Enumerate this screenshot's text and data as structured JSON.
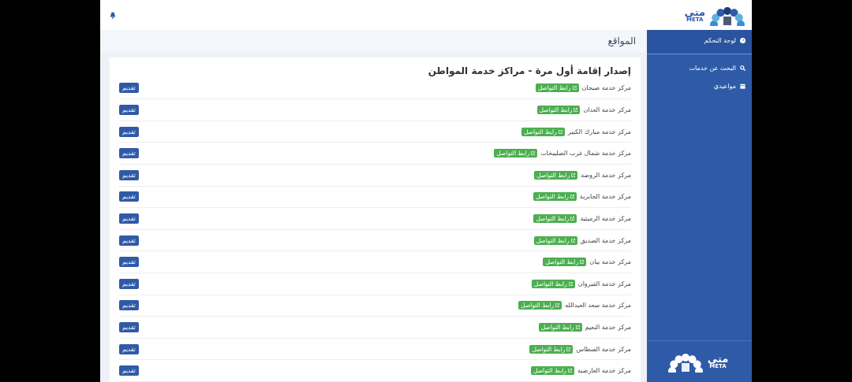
{
  "header": {
    "logo": {
      "arabic": "متى",
      "latin": "META"
    }
  },
  "sidebar": {
    "items": [
      {
        "label": "لوحة التحكم",
        "kind": "dashboard",
        "selected": true
      },
      {
        "label": "البحث عن خدمات",
        "kind": "search",
        "selected": false
      },
      {
        "label": "مواعيدي",
        "kind": "calendar",
        "selected": false
      }
    ],
    "logo": {
      "arabic": "متى",
      "latin": "META"
    }
  },
  "page_title": "المواقع",
  "section_title": "إصدار إقامة أول مرة - مراكز خدمة المواطن",
  "locations": [
    {
      "name": "مركز خدمة صبحان",
      "link": "رابط التواصل",
      "action": "تقديم"
    },
    {
      "name": "مركز خدمة العدان",
      "link": "رابط التواصل",
      "action": "تقديم"
    },
    {
      "name": "مركز خدمة مبارك الكبير",
      "link": "رابط التواصل",
      "action": "تقديم"
    },
    {
      "name": "مركز خدمة شمال غرب الصليبخات",
      "link": "رابط التواصل",
      "action": "تقديم"
    },
    {
      "name": "مركز خدمة الروضة",
      "link": "رابط التواصل",
      "action": "تقديم"
    },
    {
      "name": "مركز خدمة الجابرية",
      "link": "رابط التواصل",
      "action": "تقديم"
    },
    {
      "name": "مركز خدمة الرميثية",
      "link": "رابط التواصل",
      "action": "تقديم"
    },
    {
      "name": "مركز خدمة الصديق",
      "link": "رابط التواصل",
      "action": "تقديم"
    },
    {
      "name": "مركز خدمة بيان",
      "link": "رابط التواصل",
      "action": "تقديم"
    },
    {
      "name": "مركز خدمة القيروان",
      "link": "رابط التواصل",
      "action": "تقديم"
    },
    {
      "name": "مركز خدمة سعد العبدالله",
      "link": "رابط التواصل",
      "action": "تقديم"
    },
    {
      "name": "مركز خدمة النعيم",
      "link": "رابط التواصل",
      "action": "تقديم"
    },
    {
      "name": "مركز خدمة الفنطاس",
      "link": "رابط التواصل",
      "action": "تقديم"
    },
    {
      "name": "مركز خدمة العارضية",
      "link": "رابط التواصل",
      "action": "تقديم"
    }
  ]
}
